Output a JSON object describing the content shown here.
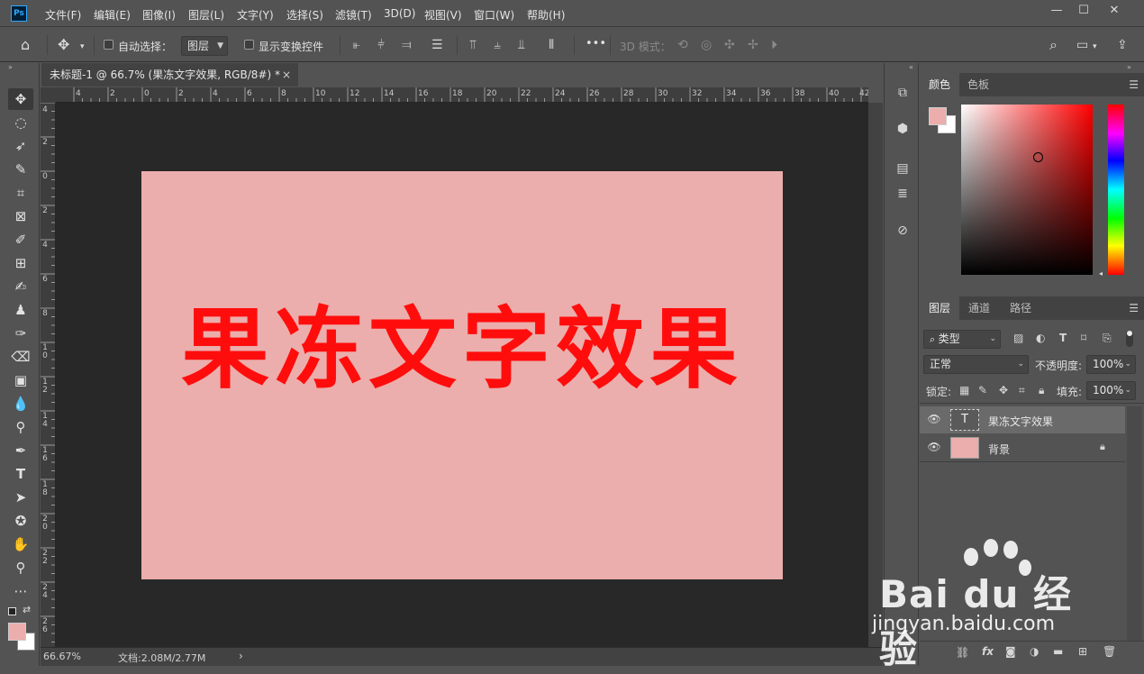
{
  "app": {
    "logo": "Ps"
  },
  "menu": [
    "文件(F)",
    "编辑(E)",
    "图像(I)",
    "图层(L)",
    "文字(Y)",
    "选择(S)",
    "滤镜(T)",
    "3D(D)",
    "视图(V)",
    "窗口(W)",
    "帮助(H)"
  ],
  "window_controls": {
    "minimize": "—",
    "maximize": "☐",
    "close": "✕"
  },
  "options_bar": {
    "auto_select_label": "自动选择：",
    "auto_select_target": "图层",
    "show_transform_label": "显示变换控件",
    "more": "•••",
    "mode_3d_label": "3D 模式："
  },
  "document": {
    "tab_title": "未标题-1 @ 66.7% (果冻文字效果, RGB/8#) *",
    "tab_close": "×",
    "canvas_text": "果冻文字效果",
    "canvas_color": "#ebaeac",
    "text_color": "#ff0d0d"
  },
  "ruler": {
    "top": [
      "4",
      "2",
      "0",
      "2",
      "4",
      "6",
      "8",
      "10",
      "12",
      "14",
      "16",
      "18",
      "20",
      "22",
      "24",
      "26",
      "28",
      "30",
      "32",
      "34",
      "36",
      "38",
      "40",
      "42"
    ],
    "left": [
      "4",
      "2",
      "0",
      "2",
      "4",
      "6",
      "8",
      "10",
      "12",
      "14",
      "16",
      "18",
      "20",
      "22",
      "24",
      "26"
    ]
  },
  "status": {
    "zoom": "66.67%",
    "doc_info": "文档:2.08M/2.77M",
    "arrow": "›"
  },
  "color_panel": {
    "tabs": [
      "颜色",
      "色板"
    ],
    "active_tab": "颜色",
    "foreground": "#ebaeac",
    "background": "#ffffff",
    "hue": "red"
  },
  "layers_panel": {
    "tabs": [
      "图层",
      "通道",
      "路径"
    ],
    "active_tab": "图层",
    "filter_kind": "类型",
    "blend_mode": "正常",
    "opacity_label": "不透明度:",
    "opacity": "100%",
    "lock_label": "锁定:",
    "fill_label": "填充:",
    "fill": "100%",
    "layers": [
      {
        "name": "果冻文字效果",
        "kind": "text",
        "thumb": "T",
        "selected": true,
        "visible": true,
        "locked": false
      },
      {
        "name": "背景",
        "kind": "fill",
        "thumb_color": "#ebaeac",
        "selected": false,
        "visible": true,
        "locked": true
      }
    ],
    "footer_icons": [
      "link-icon",
      "fx-icon",
      "mask-icon",
      "adjustment-icon",
      "folder-icon",
      "new-layer-icon",
      "trash-icon"
    ],
    "fx_label": "fx"
  },
  "watermark": {
    "brand": "Bai du 经验",
    "url": "jingyan.baidu.com"
  }
}
